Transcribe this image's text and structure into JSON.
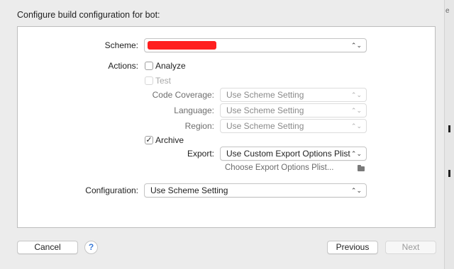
{
  "window": {
    "title": "Configure build configuration for bot:"
  },
  "side_strip": {
    "letter": "e"
  },
  "scheme": {
    "label": "Scheme:",
    "value": ""
  },
  "actions": {
    "label": "Actions:",
    "analyze": {
      "label": "Analyze",
      "checked": false
    },
    "test": {
      "label": "Test",
      "checked": false,
      "enabled": false
    },
    "code_coverage": {
      "label": "Code Coverage:",
      "value": "Use Scheme Setting"
    },
    "language": {
      "label": "Language:",
      "value": "Use Scheme Setting"
    },
    "region": {
      "label": "Region:",
      "value": "Use Scheme Setting"
    },
    "archive": {
      "label": "Archive",
      "checked": true,
      "mark": "✓"
    },
    "export": {
      "label": "Export:",
      "value": "Use Custom Export Options Plist"
    },
    "export_plist": {
      "placeholder": "Choose Export Options Plist..."
    }
  },
  "configuration": {
    "label": "Configuration:",
    "value": "Use Scheme Setting"
  },
  "footer": {
    "cancel_label": "Cancel",
    "help_label": "?",
    "previous_label": "Previous",
    "next_label": "Next"
  },
  "icons": {
    "popup_chevron": "chevron-up-down-icon",
    "folder": "folder-icon"
  },
  "colors": {
    "redaction": "#ff1f1f",
    "help_accent": "#3b7bd8"
  }
}
